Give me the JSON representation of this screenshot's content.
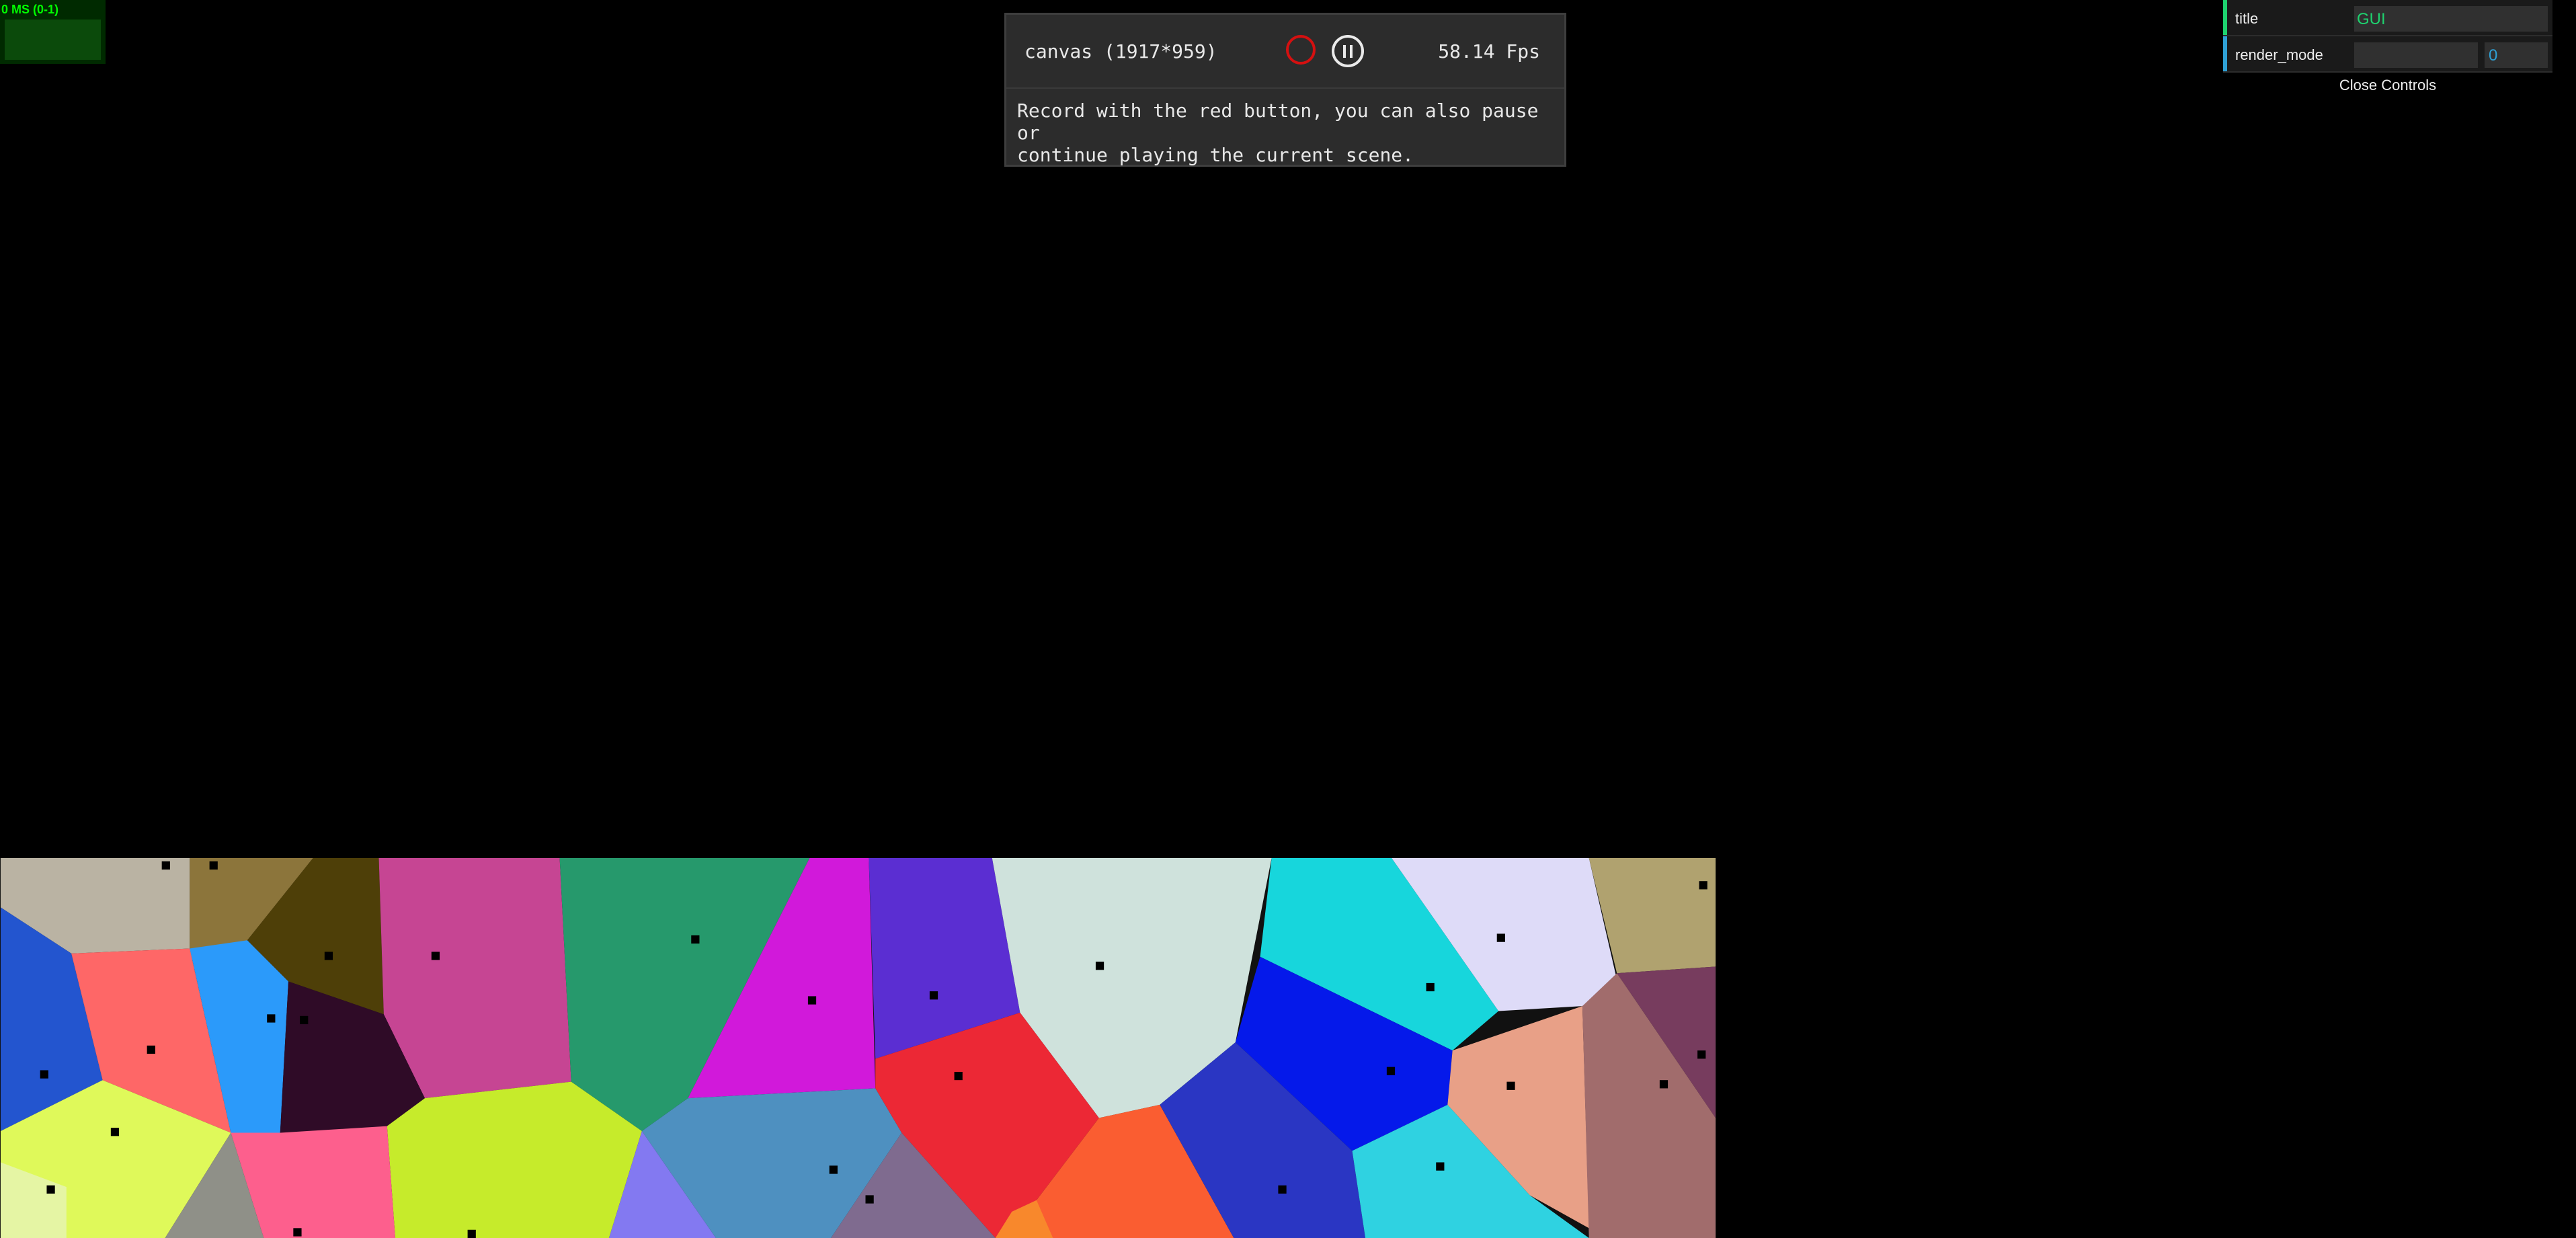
{
  "stats": {
    "label": "0 MS (0-1)"
  },
  "recorder": {
    "canvas_label": "canvas (1917*959)",
    "fps": "58.14 Fps",
    "message": "Record with the red button, you can also pause or\ncontinue playing the current scene.",
    "record_icon": "record-icon",
    "pause_icon": "pause-icon"
  },
  "gui": {
    "rows": [
      {
        "name": "title",
        "value": "GUI",
        "accent": "#1ed36f"
      },
      {
        "name": "render_mode",
        "value": "0",
        "accent": "#2fa1d6"
      }
    ],
    "close_label": "Close Controls"
  },
  "colors": {
    "record_red": "#d51010",
    "stats_green": "#00ff00",
    "gui_number": "#2fa1d6",
    "gui_string": "#1ed36f"
  }
}
